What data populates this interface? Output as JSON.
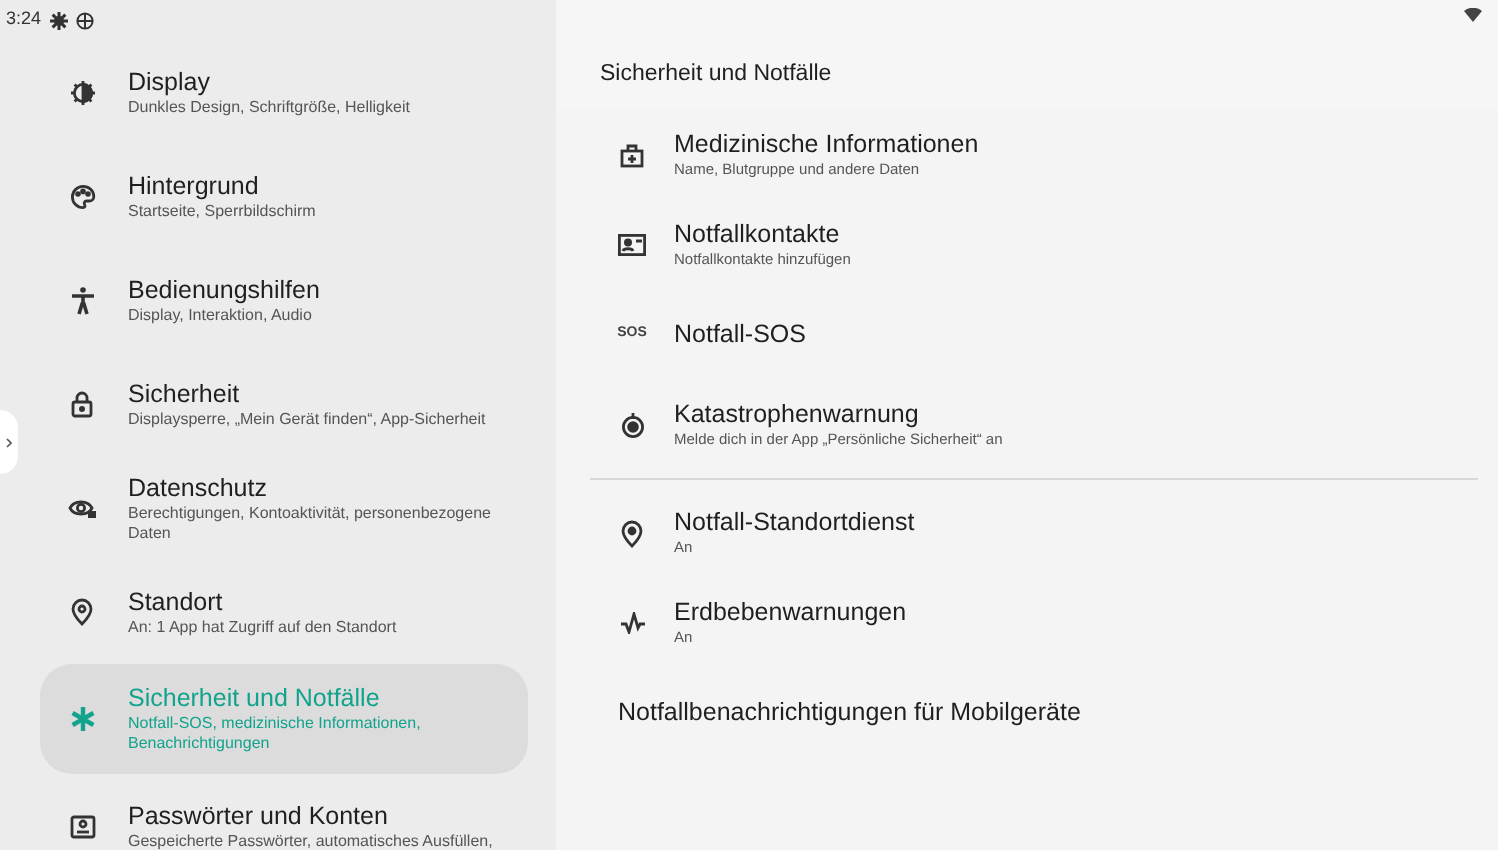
{
  "status_bar": {
    "time": "3:24"
  },
  "sidebar": {
    "items": [
      {
        "title": "Display",
        "subtitle": "Dunkles Design, Schriftgröße, Helligkeit",
        "selected": false
      },
      {
        "title": "Hintergrund",
        "subtitle": "Startseite, Sperrbildschirm",
        "selected": false
      },
      {
        "title": "Bedienungshilfen",
        "subtitle": "Display, Interaktion, Audio",
        "selected": false
      },
      {
        "title": "Sicherheit",
        "subtitle": "Displaysperre, „Mein Gerät finden“, App-Sicherheit",
        "selected": false
      },
      {
        "title": "Datenschutz",
        "subtitle": "Berechtigungen, Kontoaktivität, personenbezogene Daten",
        "selected": false
      },
      {
        "title": "Standort",
        "subtitle": "An: 1 App hat Zugriff auf den Standort",
        "selected": false
      },
      {
        "title": "Sicherheit und Notfälle",
        "subtitle": "Notfall-SOS, medizinische Informationen, Benachrichtigungen",
        "selected": true
      },
      {
        "title": "Passwörter und Konten",
        "subtitle": "Gespeicherte Passwörter, automatisches Ausfüllen,",
        "selected": false
      }
    ]
  },
  "page": {
    "title": "Sicherheit und Notfälle",
    "sections": [
      [
        {
          "title": "Medizinische Informationen",
          "subtitle": "Name, Blutgruppe und andere Daten"
        },
        {
          "title": "Notfallkontakte",
          "subtitle": "Notfallkontakte hinzufügen"
        },
        {
          "title": "Notfall-SOS",
          "icon_text": "SOS"
        },
        {
          "title": "Katastrophenwarnung",
          "subtitle": "Melde dich in der App „Persönliche Sicherheit“ an"
        }
      ],
      [
        {
          "title": "Notfall-Standortdienst",
          "subtitle": "An"
        },
        {
          "title": "Erdbebenwarnungen",
          "subtitle": "An"
        },
        {
          "title": "Notfallbenachrichtigungen für Mobilgeräte"
        }
      ]
    ]
  }
}
